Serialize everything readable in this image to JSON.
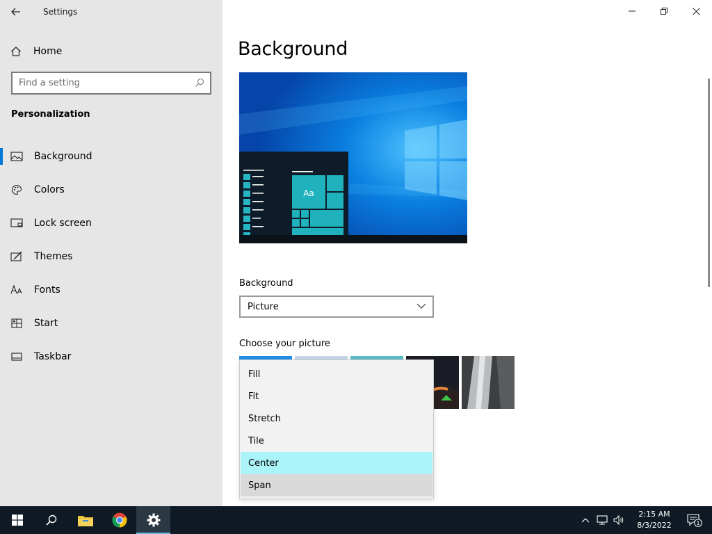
{
  "window": {
    "title": "Settings"
  },
  "sidebar": {
    "home_label": "Home",
    "search_placeholder": "Find a setting",
    "section_title": "Personalization",
    "items": [
      {
        "label": "Background",
        "icon": "picture-icon",
        "active": true
      },
      {
        "label": "Colors",
        "icon": "palette-icon"
      },
      {
        "label": "Lock screen",
        "icon": "lock-screen-icon"
      },
      {
        "label": "Themes",
        "icon": "themes-icon"
      },
      {
        "label": "Fonts",
        "icon": "fonts-icon"
      },
      {
        "label": "Start",
        "icon": "start-icon"
      },
      {
        "label": "Taskbar",
        "icon": "taskbar-icon"
      }
    ]
  },
  "main": {
    "title": "Background",
    "preview": {
      "tile_label": "Aa"
    },
    "background_label": "Background",
    "background_value": "Picture",
    "choose_picture_label": "Choose your picture",
    "fit_dropdown": {
      "options": [
        "Fill",
        "Fit",
        "Stretch",
        "Tile",
        "Center",
        "Span"
      ],
      "highlighted": "Center",
      "selected": "Span"
    }
  },
  "taskbar": {
    "clock_time": "2:15 AM",
    "clock_date": "8/3/2022",
    "notification_count": "1"
  },
  "colors": {
    "accent": "#0078d7",
    "highlight": "#aaf3f8",
    "taskbar": "#0f1a24",
    "sidebar": "#e6e6e6"
  }
}
